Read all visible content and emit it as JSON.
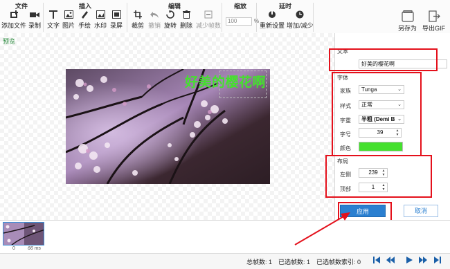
{
  "toolbar": {
    "groups": {
      "file": "文件",
      "insert": "插入",
      "edit": "编辑",
      "zoom": "缩放",
      "delay": "延时"
    },
    "buttons": {
      "add_file": "添加文件",
      "record": "录制",
      "text": "文字",
      "image": "图片",
      "hand_draw": "手绘",
      "watermark": "水印",
      "screen_record": "录屏",
      "crop": "裁剪",
      "undo": "撤销",
      "rotate": "旋转",
      "delete": "删除",
      "reduce_frames": "减少帧数",
      "reset": "重新设置",
      "add_reduce": "增加/减少",
      "save_as": "另存为",
      "export_gif": "导出GIF"
    },
    "zoom_value": "100",
    "zoom_unit": "%"
  },
  "preview": {
    "label": "预览",
    "overlay_text": "好美的樱花啊"
  },
  "panel": {
    "text_section": "文本",
    "text_value": "好美的樱花啊",
    "font_section": "字体",
    "font_family_label": "家族",
    "font_family_value": "Tunga",
    "style_label": "样式",
    "style_value": "正常",
    "weight_label": "字重",
    "weight_value": "半粗 (Demi B",
    "size_label": "字号",
    "size_value": "39",
    "color_label": "颜色",
    "color_value": "#45e02e",
    "layout_section": "布局",
    "left_label": "左侧",
    "left_value": "239",
    "top_label": "顶部",
    "top_value": "1",
    "apply_label": "应用",
    "cancel_label": "取消"
  },
  "filmstrip": {
    "frame_index": "0",
    "frame_time": "66 ms"
  },
  "status": {
    "total_frames": "总帧数: 1",
    "selected_frames": "已选帧数: 1",
    "selected_index": "已选帧数索引: 0"
  },
  "colors": {
    "accent": "#2a7fd0",
    "annotation_red": "#e4101b",
    "text_green": "#45e02e"
  }
}
